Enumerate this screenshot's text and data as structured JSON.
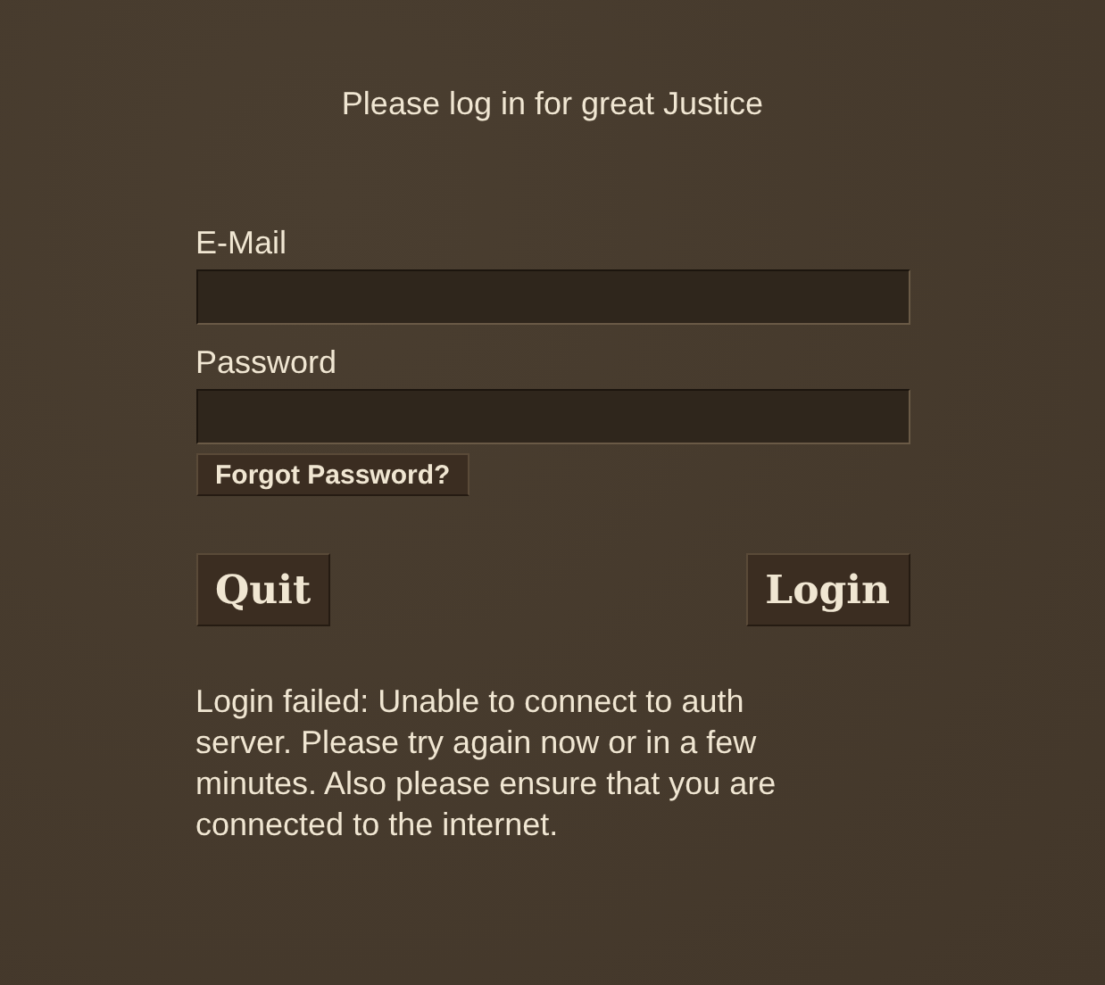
{
  "heading": "Please log in for great Justice",
  "fields": [
    {
      "label": "E-Mail"
    },
    {
      "label": "Password"
    }
  ],
  "forgot_link": "Forgot Password?",
  "buttons": [
    {
      "label": "Quit"
    },
    {
      "label": "Login"
    }
  ],
  "error_message": "Login failed: Unable to connect to auth server. Please try again now or in a few minutes. Also please ensure that you are connected to the internet."
}
